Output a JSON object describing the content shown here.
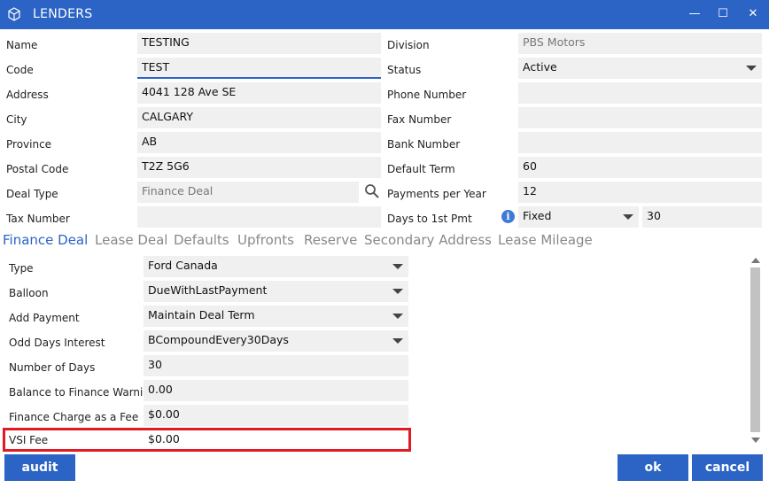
{
  "window": {
    "title": "LENDERS",
    "minimize_glyph": "—",
    "maximize_glyph": "☐",
    "close_glyph": "✕"
  },
  "form": {
    "name": {
      "label": "Name",
      "value": "TESTING"
    },
    "code": {
      "label": "Code",
      "value": "TEST"
    },
    "address": {
      "label": "Address",
      "value": "4041 128 Ave SE"
    },
    "city": {
      "label": "City",
      "value": "CALGARY"
    },
    "province": {
      "label": "Province",
      "value": "AB"
    },
    "postal_code": {
      "label": "Postal Code",
      "value": "T2Z 5G6"
    },
    "deal_type": {
      "label": "Deal Type",
      "value": "Finance Deal"
    },
    "tax_number": {
      "label": "Tax Number",
      "value": ""
    },
    "division": {
      "label": "Division",
      "value": "PBS Motors"
    },
    "status": {
      "label": "Status",
      "value": "Active"
    },
    "phone_number": {
      "label": "Phone Number",
      "value": ""
    },
    "fax_number": {
      "label": "Fax Number",
      "value": ""
    },
    "bank_number": {
      "label": "Bank Number",
      "value": ""
    },
    "default_term": {
      "label": "Default Term",
      "value": "60"
    },
    "payments_per_year": {
      "label": "Payments per Year",
      "value": "12"
    },
    "days_to_first_pmt": {
      "label": "Days to 1st Pmt",
      "mode": "Fixed",
      "value": "30"
    }
  },
  "tabs": [
    "Finance Deal",
    "Lease Deal",
    "Defaults",
    "Upfronts",
    "Reserve",
    "Secondary Address",
    "Lease Mileage"
  ],
  "finance": {
    "type": {
      "label": "Type",
      "value": "Ford Canada"
    },
    "balloon": {
      "label": "Balloon",
      "value": "DueWithLastPayment"
    },
    "add_payment": {
      "label": "Add Payment",
      "value": "Maintain Deal Term"
    },
    "odd_days_interest": {
      "label": "Odd Days Interest",
      "value": "BCompoundEvery30Days"
    },
    "number_of_days": {
      "label": "Number of Days",
      "value": "30"
    },
    "balance_warning": {
      "label": "Balance to Finance Warning",
      "value": "0.00"
    },
    "finance_charge_fee": {
      "label": "Finance Charge as a Fee",
      "value": "$0.00"
    },
    "vsi_fee": {
      "label": "VSI Fee",
      "value": "$0.00"
    }
  },
  "buttons": {
    "audit": "audit",
    "ok": "ok",
    "cancel": "cancel"
  },
  "colors": {
    "accent": "#2b64c4",
    "highlight": "#e01b24",
    "field_bg": "#f0f0f0"
  },
  "icons": [
    "cube-icon",
    "search-icon",
    "info-icon",
    "dropdown-caret-icon"
  ]
}
